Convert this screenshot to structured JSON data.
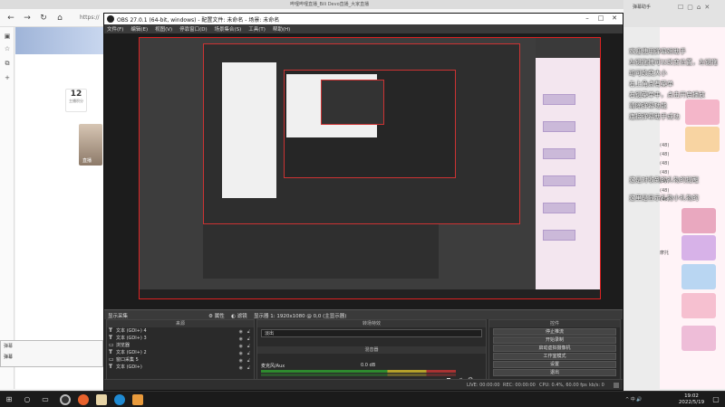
{
  "browser": {
    "tab_title": "哔哩哔哩直播_Bili Devo直播_大家直播",
    "address": "https://",
    "cards": [
      {
        "num": "12",
        "sub": "主播积分"
      },
      {
        "num": "12",
        "sub": "主播积分"
      }
    ],
    "thumb_label": "直播"
  },
  "chat": {
    "window_title": "弹幕助手",
    "messages": [
      "欢迎使用弹幕姬助手",
      "左键拖拽可以改变位置，左键拖",
      "动可改变大小",
      "右上角点有菜单",
      "右键菜单中，点击开启播放",
      "清除弹幕功能",
      "连接弹幕助手成功",
      "这是对收到的礼物的提醒",
      "这里是显示礼物小礼物的"
    ],
    "side_labels": [
      "主播守护",
      "弹幕守护",
      "5000",
      "本周",
      "本场"
    ],
    "rank_labels": [
      "(48)",
      "(48)",
      "(48)",
      "(48)",
      "(48)",
      "(48)",
      "(48)",
      "摩托"
    ]
  },
  "obs": {
    "title": "OBS 27.0.1 (64-bit, windows) - 配置文件: 未命名 - 场景: 未命名",
    "menu": [
      "文件(F)",
      "编辑(E)",
      "视图(V)",
      "停靠窗口(D)",
      "场景集合(S)",
      "工具(T)",
      "帮助(H)"
    ],
    "dock_strip": {
      "source_tag": "显示采集",
      "props": "属性",
      "filters": "滤镜",
      "display": "显示器 1: 1920x1080 @ 0,0 (主显示器)"
    },
    "sources": {
      "header": "来源",
      "items": [
        {
          "icon": "T",
          "label": "文本 (GDI+) 4"
        },
        {
          "icon": "T",
          "label": "文本 (GDI+) 3"
        },
        {
          "icon": "▭",
          "label": "浏览器"
        },
        {
          "icon": "T",
          "label": "文本 (GDI+) 2"
        },
        {
          "icon": "▭",
          "label": "窗口采集 5"
        },
        {
          "icon": "T",
          "label": "文本 (GDI+)"
        }
      ]
    },
    "transitions": {
      "header": "转场特效",
      "selected": "淡出"
    },
    "mixer": {
      "header": "混音器",
      "track": "麦克风/Aux",
      "level": "0.0 dB"
    },
    "controls": {
      "header": "控件",
      "buttons": [
        "停止推流",
        "开始录制",
        "启动虚拟摄像机",
        "工作室模式",
        "设置",
        "退出"
      ]
    },
    "status": {
      "live": "LIVE: 00:00:00",
      "rec": "REC: 00:00:00",
      "cpu": "CPU: 0.4%, 60.00 fps",
      "kbps": "kb/s: 0"
    }
  },
  "float_window": {
    "title": "弹幕",
    "row": "弹幕"
  },
  "taskbar": {
    "time": "19:02",
    "date": "2022/5/19",
    "tray_text": "^ 中 🔊"
  }
}
